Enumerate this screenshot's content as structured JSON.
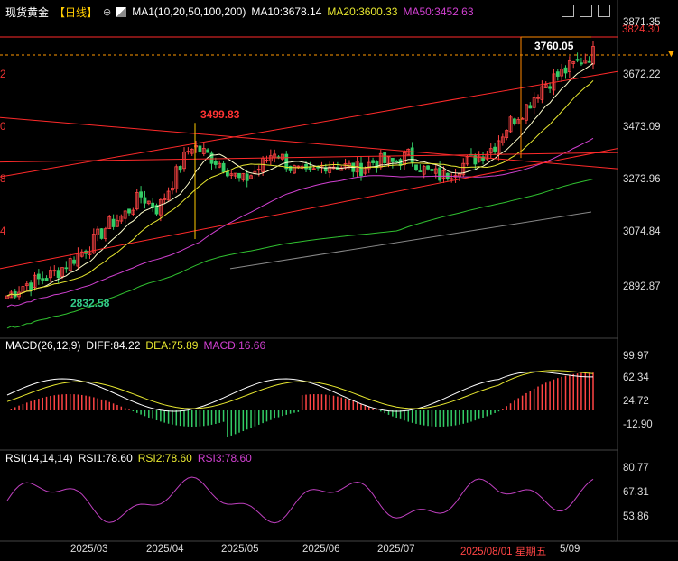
{
  "instrument": {
    "name": "现货黄金",
    "period": "【日线】",
    "zoom_icon": "zoom-icon"
  },
  "legend_ma": {
    "ma1": "MA1(10,20,50,100,200)",
    "ma10": "MA10:3678.14",
    "ma20": "MA20:3600.33",
    "ma50": "MA50:3452.63"
  },
  "main_axis": {
    "top_value": "3824.30",
    "ticks": [
      "3871.35",
      "3672.22",
      "3473.09",
      "3273.96",
      "3074.84",
      "2892.87"
    ],
    "left_ticks": [
      "2",
      "0",
      "8",
      "4"
    ]
  },
  "annotations": {
    "high_3760": "3760.05",
    "high_3499": "3499.83",
    "low_2832": "2832.58"
  },
  "macd": {
    "title": "MACD(26,12,9)",
    "diff": "DIFF:84.22",
    "dea": "DEA:75.89",
    "macd": "MACD:16.66",
    "ticks": [
      "99.97",
      "62.34",
      "24.72",
      "-12.90"
    ]
  },
  "rsi": {
    "title": "RSI(14,14,14)",
    "rsi1": "RSI1:78.60",
    "rsi2": "RSI2:78.60",
    "rsi3": "RSI3:78.60",
    "ticks": [
      "80.77",
      "67.31",
      "53.86"
    ]
  },
  "x_axis": {
    "labels": [
      "2025/03",
      "2025/04",
      "2025/05",
      "2025/06",
      "2025/07",
      "5/09"
    ],
    "cursor_label": "2025/08/01 星期五"
  },
  "colors": {
    "up": "#ff4444",
    "down": "#33cc66",
    "ma10": "#ffffcc",
    "ma20": "#e8e830",
    "ma50": "#d040d0",
    "ma100": "#30c030",
    "ma200": "#888888",
    "trend": "#ff2a2a",
    "rsi": "#c040c0"
  },
  "chart_data": {
    "type": "candlestick",
    "approx_close_path": [
      2860,
      2900,
      2920,
      2950,
      3000,
      3050,
      3120,
      3160,
      3230,
      3180,
      3300,
      3420,
      3380,
      3340,
      3280,
      3330,
      3400,
      3330,
      3300,
      3350,
      3340,
      3330,
      3360,
      3350,
      3380,
      3320,
      3300,
      3340,
      3370,
      3410,
      3500,
      3560,
      3640,
      3680,
      3720,
      3760
    ],
    "ma_labels": [
      "MA10",
      "MA20",
      "MA50",
      "MA100",
      "MA200"
    ]
  }
}
